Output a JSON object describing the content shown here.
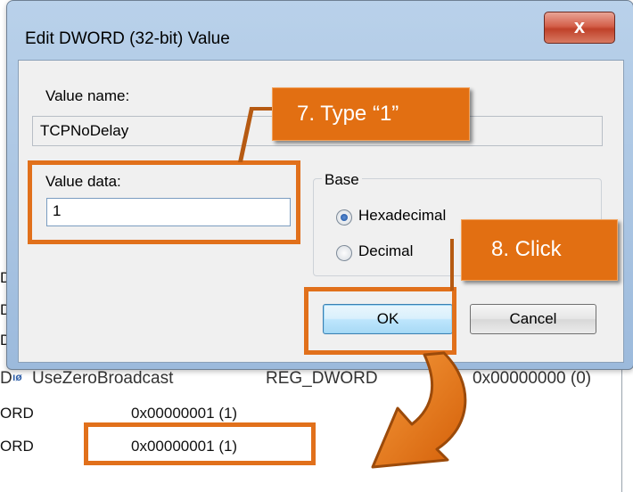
{
  "dialog": {
    "title": "Edit DWORD (32-bit) Value",
    "close_glyph": "x",
    "value_name_label": "Value name:",
    "value_name": "TCPNoDelay",
    "value_data_label": "Value data:",
    "value_data": "1",
    "base_label": "Base",
    "radio_hex_label": "Hexadecimal",
    "radio_dec_label": "Decimal",
    "selected_base": "Hexadecimal",
    "ok_label": "OK",
    "cancel_label": "Cancel"
  },
  "background_list": {
    "partial_row": {
      "name": "UseZeroBroadcast",
      "type": "REG_DWORD",
      "data": "0x00000000 (0)"
    },
    "rows": [
      {
        "type_fragment": "ORD",
        "data": "0x00000001 (1)"
      },
      {
        "type_fragment": "ORD",
        "data": "0x00000001 (1)"
      }
    ],
    "left_edge_fragments": [
      "D",
      "D",
      "D",
      "D"
    ]
  },
  "annotations": {
    "step7": "7.  Type “1”",
    "step8": "8.  Click",
    "accent_color": "#e26f12"
  },
  "icons": {
    "close": "close-icon",
    "registry_value": "registry-dword-icon",
    "arrow": "curved-arrow-icon"
  }
}
